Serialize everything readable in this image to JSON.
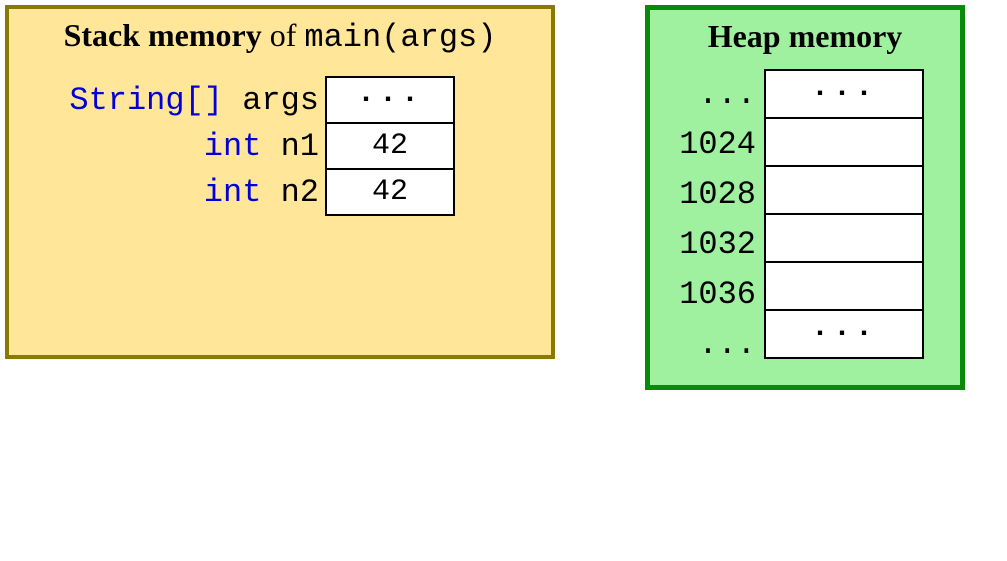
{
  "stack": {
    "title_bold": "Stack memory",
    "title_of": " of ",
    "title_mono": "main(args)",
    "rows": [
      {
        "type": "String[]",
        "name": "args",
        "value": "···"
      },
      {
        "type": "int",
        "name": "n1",
        "value": "42"
      },
      {
        "type": "int",
        "name": "n2",
        "value": "42"
      }
    ]
  },
  "heap": {
    "title": "Heap memory",
    "rows": [
      {
        "addr": "...",
        "value": "···"
      },
      {
        "addr": "1024",
        "value": ""
      },
      {
        "addr": "1028",
        "value": ""
      },
      {
        "addr": "1032",
        "value": ""
      },
      {
        "addr": "1036",
        "value": ""
      },
      {
        "addr": "...",
        "value": "···"
      }
    ]
  },
  "colors": {
    "stack_border": "#8a7a00",
    "stack_bg": "#ffe699",
    "heap_border": "#0a8a0a",
    "heap_bg": "#9ff09f",
    "type_kw": "#0000dd"
  }
}
